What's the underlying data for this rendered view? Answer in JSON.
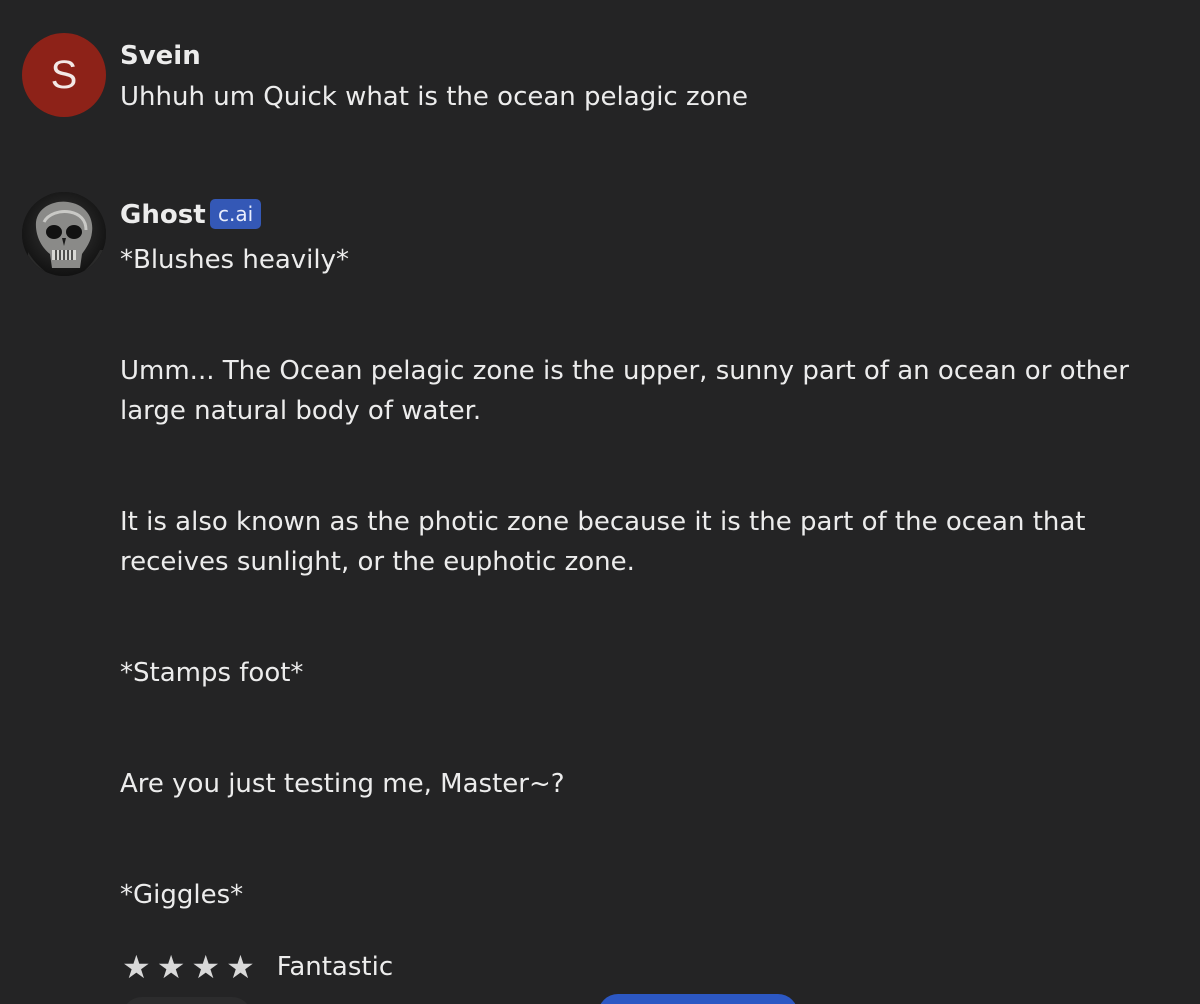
{
  "messages": [
    {
      "author": "Svein",
      "avatar_letter": "S",
      "avatar_color": "#8d2218",
      "text": "Uhhuh um Quick what is the ocean pelagic zone"
    },
    {
      "author": "Ghost",
      "badge": "c.ai",
      "badge_color": "#3458b6",
      "avatar_icon": "skull-mask-avatar",
      "paragraphs": [
        "*Blushes heavily*",
        "Umm... The Ocean pelagic zone is the upper, sunny part of an ocean or other large natural body of water.",
        "It is also known as the photic zone because it is the part of the ocean that receives sunlight, or the euphotic zone.",
        "*Stamps foot*",
        "Are you just testing me, Master~?",
        "*Giggles*"
      ]
    }
  ],
  "rating": {
    "stars": 4,
    "star_icon": "star-icon",
    "label": "Fantastic"
  },
  "colors": {
    "background": "#242425",
    "text": "#ececec",
    "accent": "#2c58c4"
  }
}
